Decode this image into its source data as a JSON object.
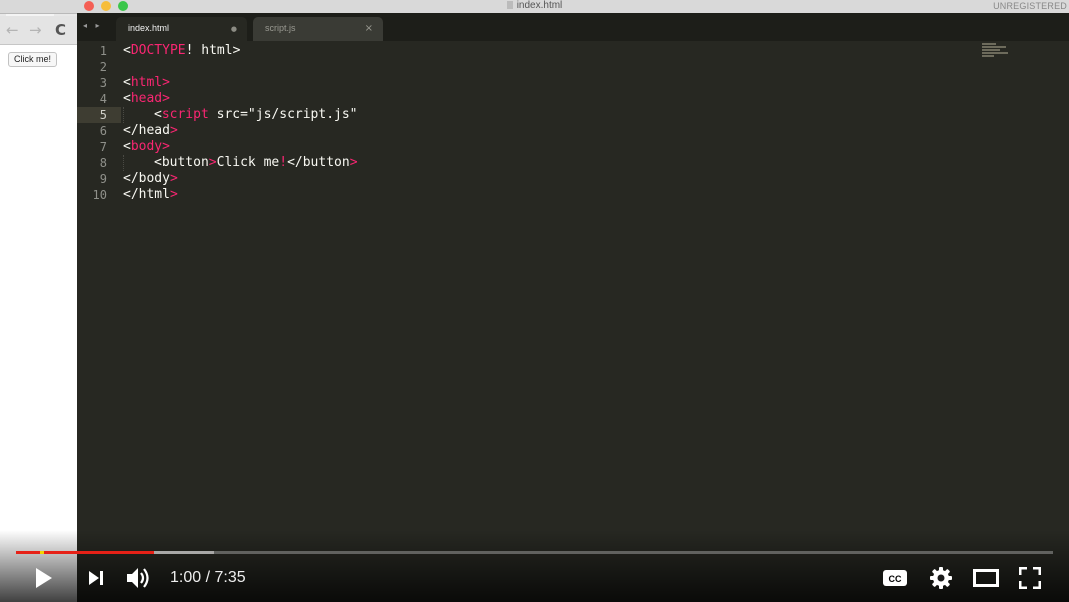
{
  "window": {
    "title": "index.html",
    "status": "UNREGISTERED"
  },
  "browser": {
    "nav": {
      "back_icon": "←",
      "forward_icon": "→",
      "reload_icon": "C"
    },
    "page_button_label": "Click me!"
  },
  "editor": {
    "tab_arrows": "◂ ▸",
    "tabs": [
      {
        "label": "index.html",
        "close": "●",
        "active": true
      },
      {
        "label": "script.js",
        "close": "×",
        "active": false
      }
    ],
    "active_line": 5,
    "line_numbers": [
      "1",
      "2",
      "3",
      "4",
      "5",
      "6",
      "7",
      "8",
      "9",
      "10"
    ],
    "code_lines": [
      "<DOCTYPE! html>",
      "",
      "<html>",
      "<head>",
      "    <script src=\"js/script.js\"",
      "</head>",
      "<body>",
      "    <button>Click me!</button>",
      "</body>",
      "</html>"
    ],
    "syntax_colors": {
      "tag": "#f92672",
      "attribute": "#a6e22e",
      "string": "#e6db74",
      "text": "#f8f8f2",
      "background": "#272822"
    }
  },
  "player": {
    "time_display": "1:00 / 7:35",
    "progress_fraction": 0.133,
    "buffered_fraction": 0.191,
    "progress_color": "#e62117",
    "icons": [
      "play-icon",
      "next-icon",
      "volume-icon",
      "cc-icon",
      "settings-icon",
      "theater-icon",
      "fullscreen-icon"
    ],
    "cc_label": "CC"
  }
}
